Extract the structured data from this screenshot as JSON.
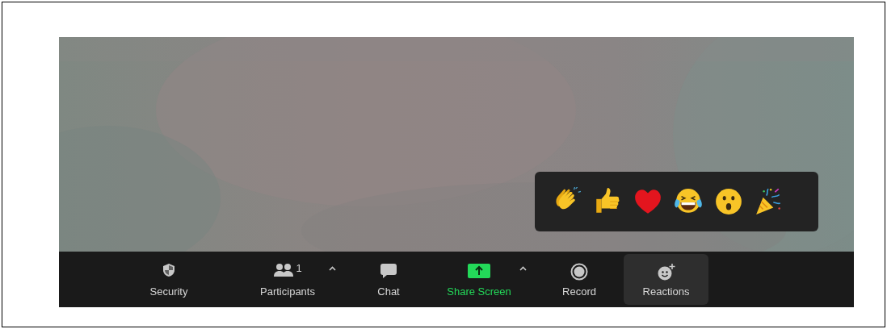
{
  "reactions_popup": {
    "open": true
  },
  "toolbar": {
    "buttons": [
      {
        "label": "Security",
        "kind": "plain",
        "selected": false,
        "has_menu": false
      },
      {
        "label": "Participants",
        "kind": "plain",
        "selected": false,
        "has_menu": true,
        "count": "1"
      },
      {
        "label": "Chat",
        "kind": "plain",
        "selected": false,
        "has_menu": false
      },
      {
        "label": "Share Screen",
        "kind": "share",
        "selected": false,
        "has_menu": true
      },
      {
        "label": "Record",
        "kind": "plain",
        "selected": false,
        "has_menu": false
      },
      {
        "label": "Reactions",
        "kind": "plain",
        "selected": true,
        "has_menu": false
      }
    ]
  }
}
